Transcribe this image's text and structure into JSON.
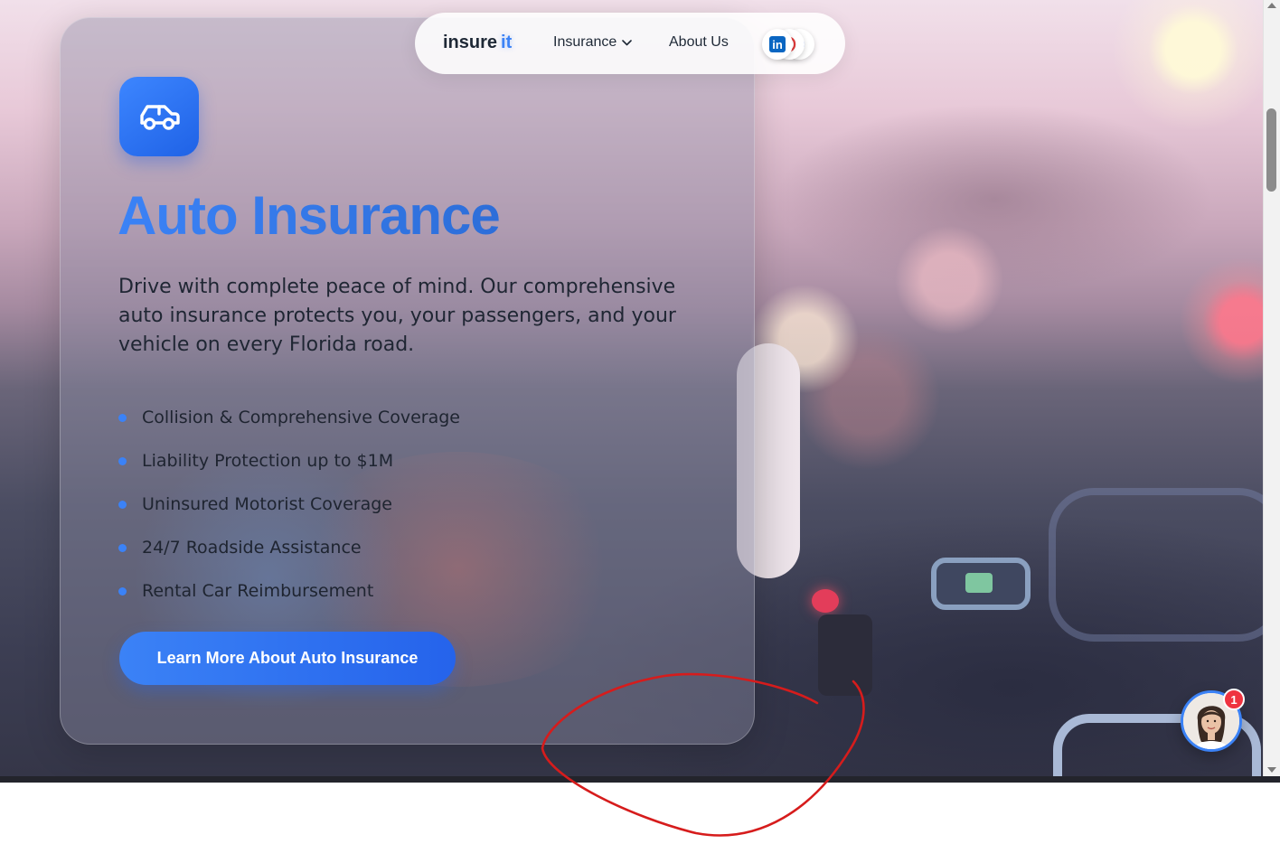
{
  "nav": {
    "logo_text": "insure",
    "logo_accent": "it",
    "items": [
      {
        "label": "Insurance",
        "has_dropdown": true
      },
      {
        "label": "About Us"
      }
    ],
    "social_icons": [
      "linkedin-icon",
      "social-icon-red",
      "social-icon-blue"
    ]
  },
  "hero": {
    "icon": "car-icon",
    "title": "Auto Insurance",
    "description": "Drive with complete peace of mind. Our comprehensive auto insurance protects you, your passengers, and your vehicle on every Florida road.",
    "features": [
      "Collision & Comprehensive Coverage",
      "Liability Protection up to $1M",
      "Uninsured Motorist Coverage",
      "24/7 Roadside Assistance",
      "Rental Car Reimbursement"
    ],
    "cta_label": "Learn More About Auto Insurance"
  },
  "chat": {
    "avatar": "support-agent-avatar",
    "badge_count": "1"
  },
  "colors": {
    "accent": "#3b82f6",
    "badge": "#ef3340",
    "annotation_stroke": "#d61c1c"
  }
}
